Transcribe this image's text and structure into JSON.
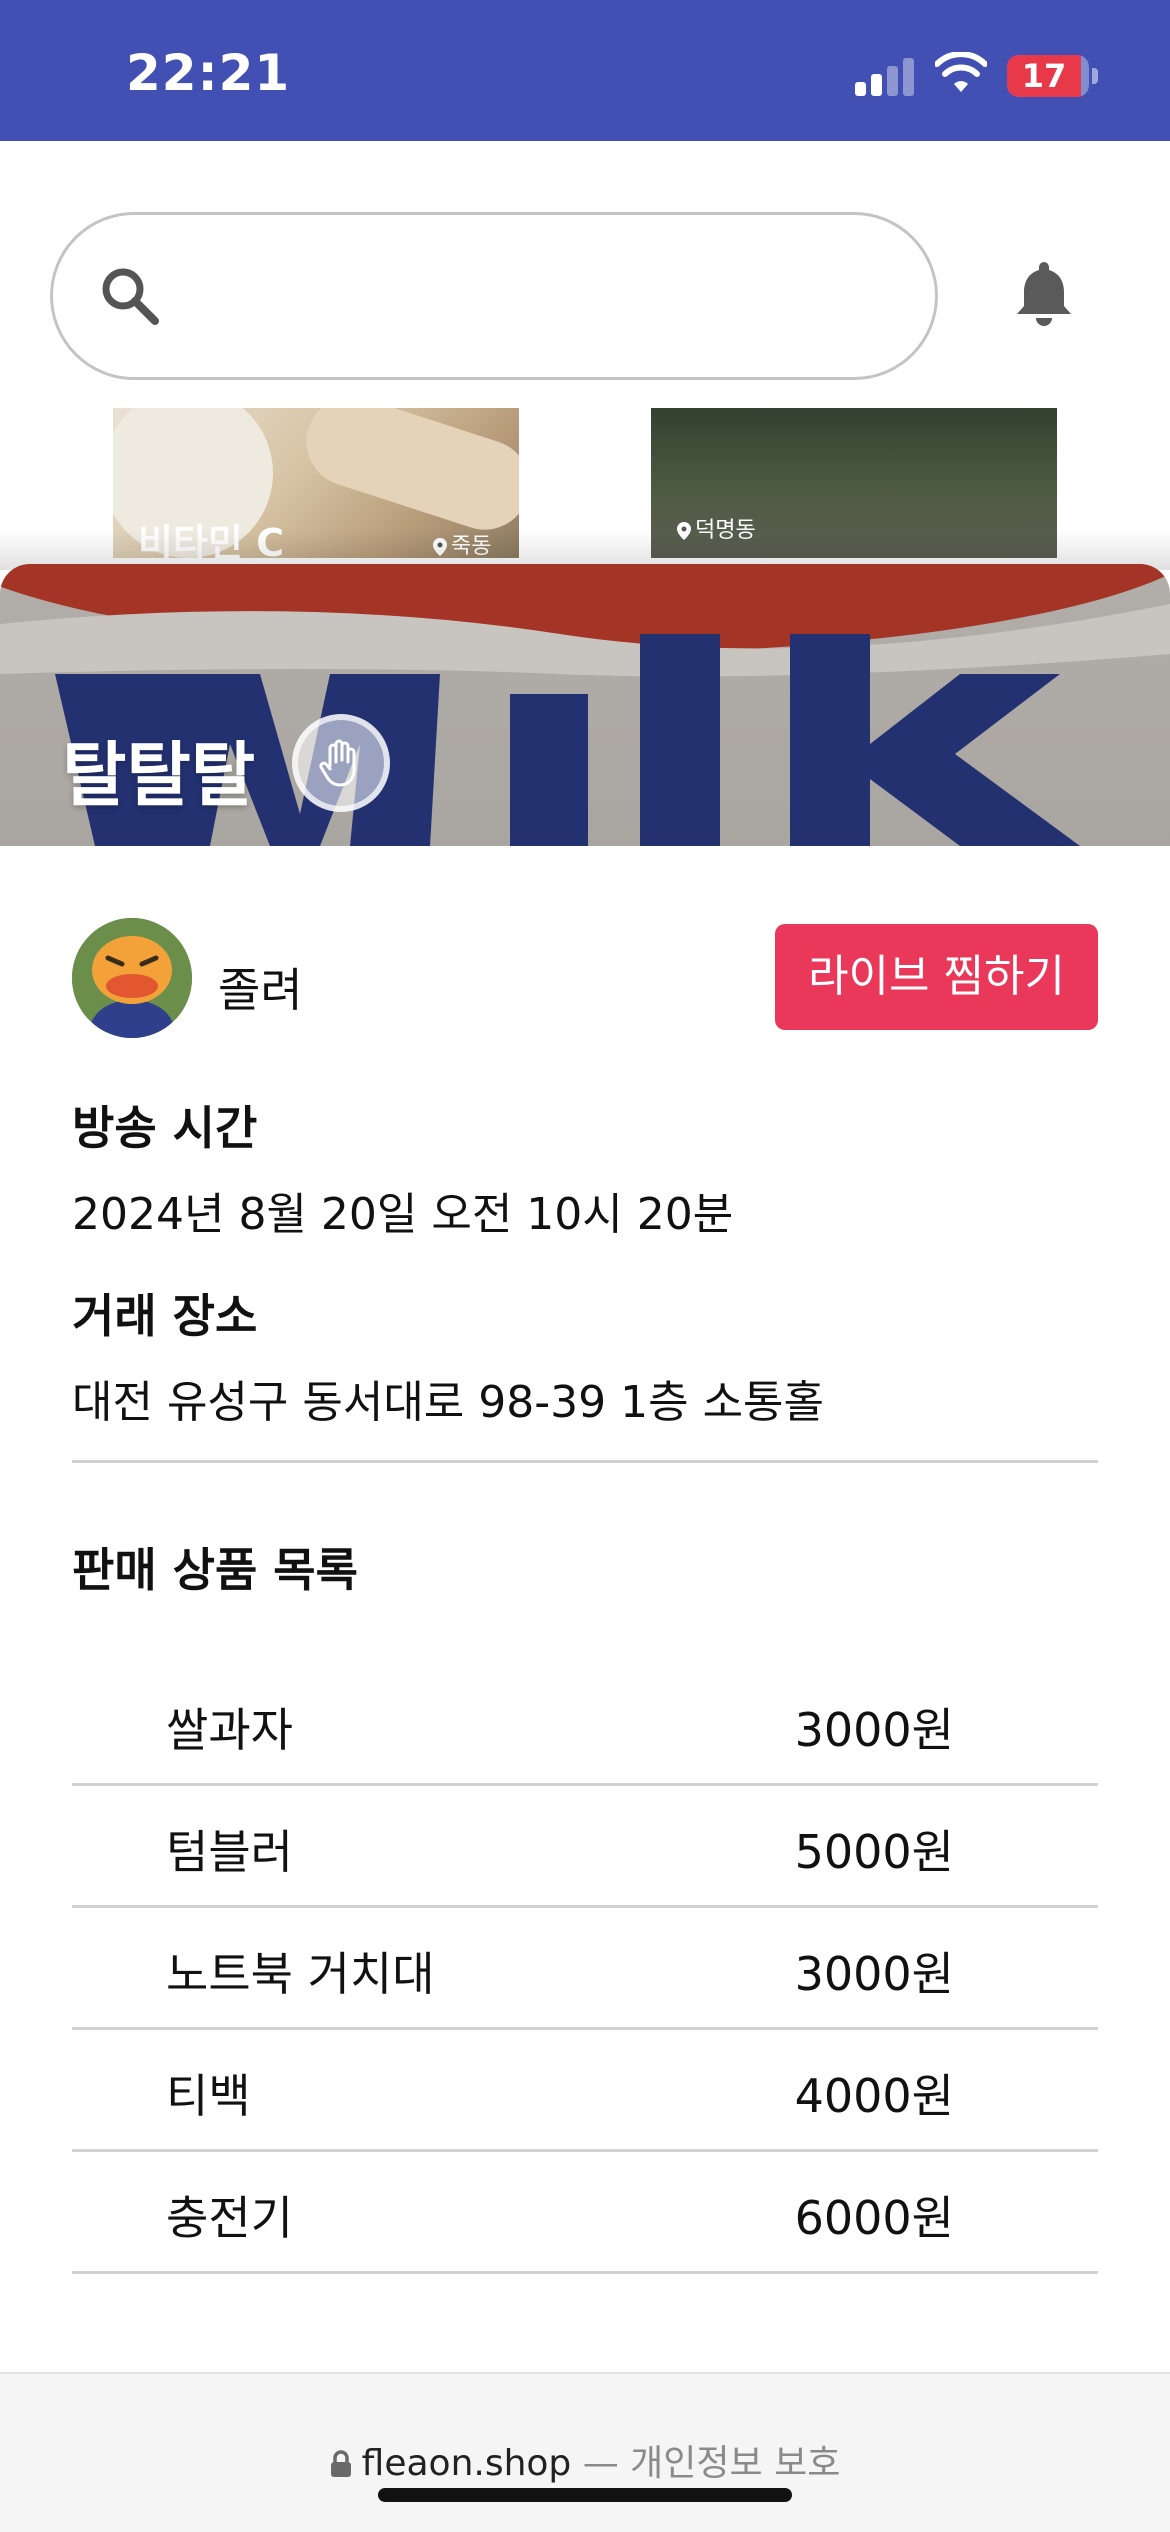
{
  "status_bar": {
    "time": "22:21",
    "battery": "17",
    "battery_level_percent": 17,
    "signal_bars_active": 2
  },
  "search": {
    "value": "",
    "placeholder": ""
  },
  "background_cards": [
    {
      "title": "비타민 C",
      "location": "죽동"
    },
    {
      "title": "",
      "location": "덕명동"
    }
  ],
  "live": {
    "title": "탈탈탈",
    "seller": "졸려",
    "wish_label": "라이브 찜하기",
    "time_label": "방송 시간",
    "time_value": "2024년 8월 20일 오전 10시 20분",
    "place_label": "거래 장소",
    "place_value": "대전 유성구 동서대로 98-39 1층 소통홀",
    "products_label": "판매 상품 목록",
    "products": [
      {
        "name": "쌀과자",
        "price": "3000원"
      },
      {
        "name": "텀블러",
        "price": "5000원"
      },
      {
        "name": "노트북 거치대",
        "price": "3000원"
      },
      {
        "name": "티백",
        "price": "4000원"
      },
      {
        "name": "충전기",
        "price": "6000원"
      }
    ]
  },
  "browser": {
    "domain": "fleaon.shop",
    "separator": " — 개인정보 보호"
  },
  "colors": {
    "status_bar": "#4150b2",
    "accent_button": "#e9385a",
    "battery_low": "#e8394a"
  },
  "icons": [
    "search-icon",
    "bell-icon",
    "location-pin-icon",
    "hand-icon",
    "lock-icon"
  ]
}
